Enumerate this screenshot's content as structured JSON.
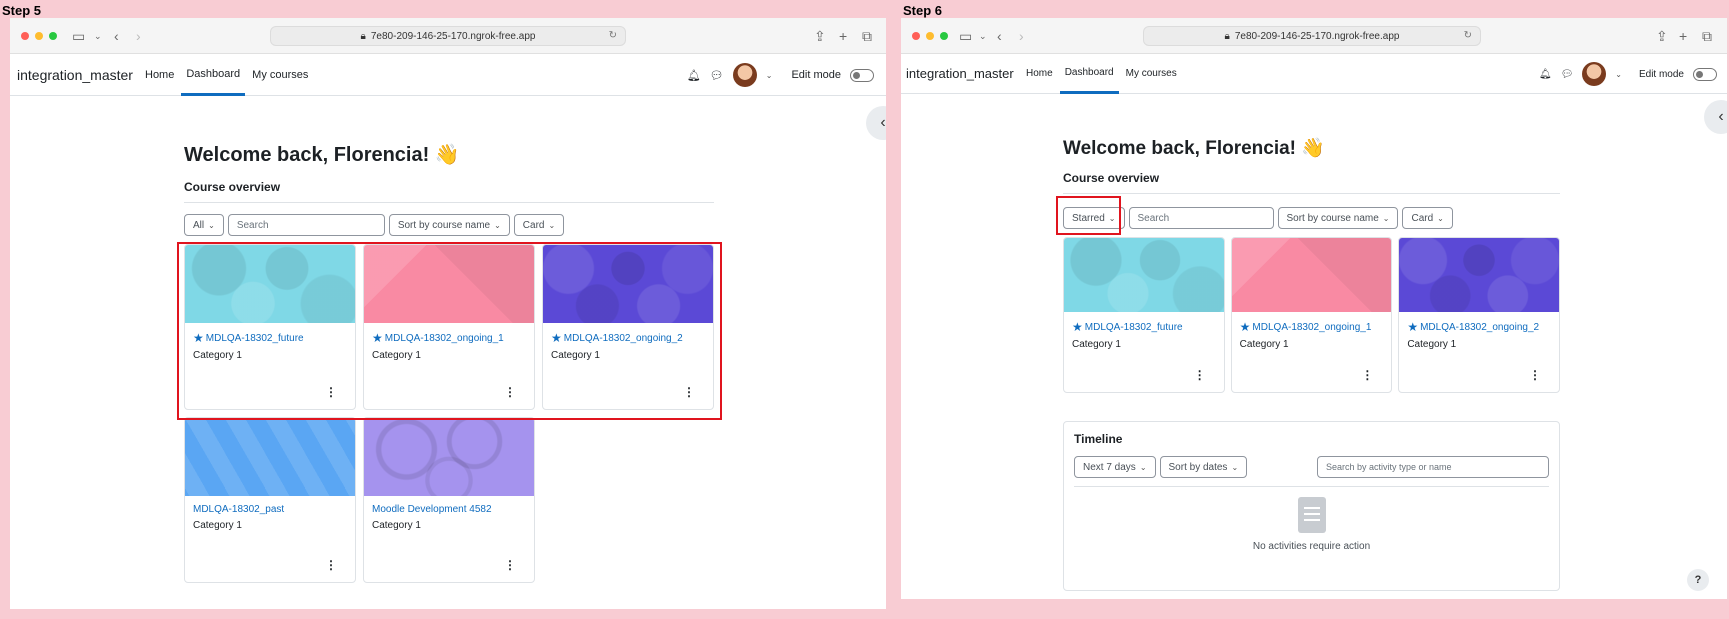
{
  "step5": {
    "label": "Step 5",
    "url": "7e80-209-146-25-170.ngrok-free.app",
    "brand": "integration_master",
    "nav": [
      "Home",
      "Dashboard",
      "My courses"
    ],
    "edit_mode": "Edit mode",
    "welcome": "Welcome back, Florencia! 👋",
    "overview_title": "Course overview",
    "filter_all": "All",
    "search_placeholder": "Search",
    "sort": "Sort by course name",
    "view": "Card",
    "courses": [
      {
        "title": "MDLQA-18302_future",
        "category": "Category 1",
        "starred": true,
        "color": "#7fd8e6"
      },
      {
        "title": "MDLQA-18302_ongoing_1",
        "category": "Category 1",
        "starred": true,
        "color": "#f98aa3"
      },
      {
        "title": "MDLQA-18302_ongoing_2",
        "category": "Category 1",
        "starred": true,
        "color": "#5b49d6"
      },
      {
        "title": "MDLQA-18302_past",
        "category": "Category 1",
        "starred": false,
        "color": "#5aa6f3"
      },
      {
        "title": "Moodle Development 4582",
        "category": "Category 1",
        "starred": false,
        "color": "#a593ee"
      }
    ]
  },
  "step6": {
    "label": "Step 6",
    "url": "7e80-209-146-25-170.ngrok-free.app",
    "brand": "integration_master",
    "nav": [
      "Home",
      "Dashboard",
      "My courses"
    ],
    "edit_mode": "Edit mode",
    "welcome": "Welcome back, Florencia! 👋",
    "overview_title": "Course overview",
    "filter_starred": "Starred",
    "search_placeholder": "Search",
    "sort": "Sort by course name",
    "view": "Card",
    "courses": [
      {
        "title": "MDLQA-18302_future",
        "category": "Category 1",
        "starred": true,
        "color": "#7fd8e6"
      },
      {
        "title": "MDLQA-18302_ongoing_1",
        "category": "Category 1",
        "starred": true,
        "color": "#f98aa3"
      },
      {
        "title": "MDLQA-18302_ongoing_2",
        "category": "Category 1",
        "starred": true,
        "color": "#5b49d6"
      }
    ],
    "timeline": {
      "title": "Timeline",
      "range": "Next 7 days",
      "sort": "Sort by dates",
      "search_placeholder": "Search by activity type or name",
      "empty": "No activities require action"
    },
    "help": "?"
  },
  "colors": {
    "accent": "#0f6cbf",
    "highlight": "#e0141e",
    "background": "#f8ccd3"
  }
}
